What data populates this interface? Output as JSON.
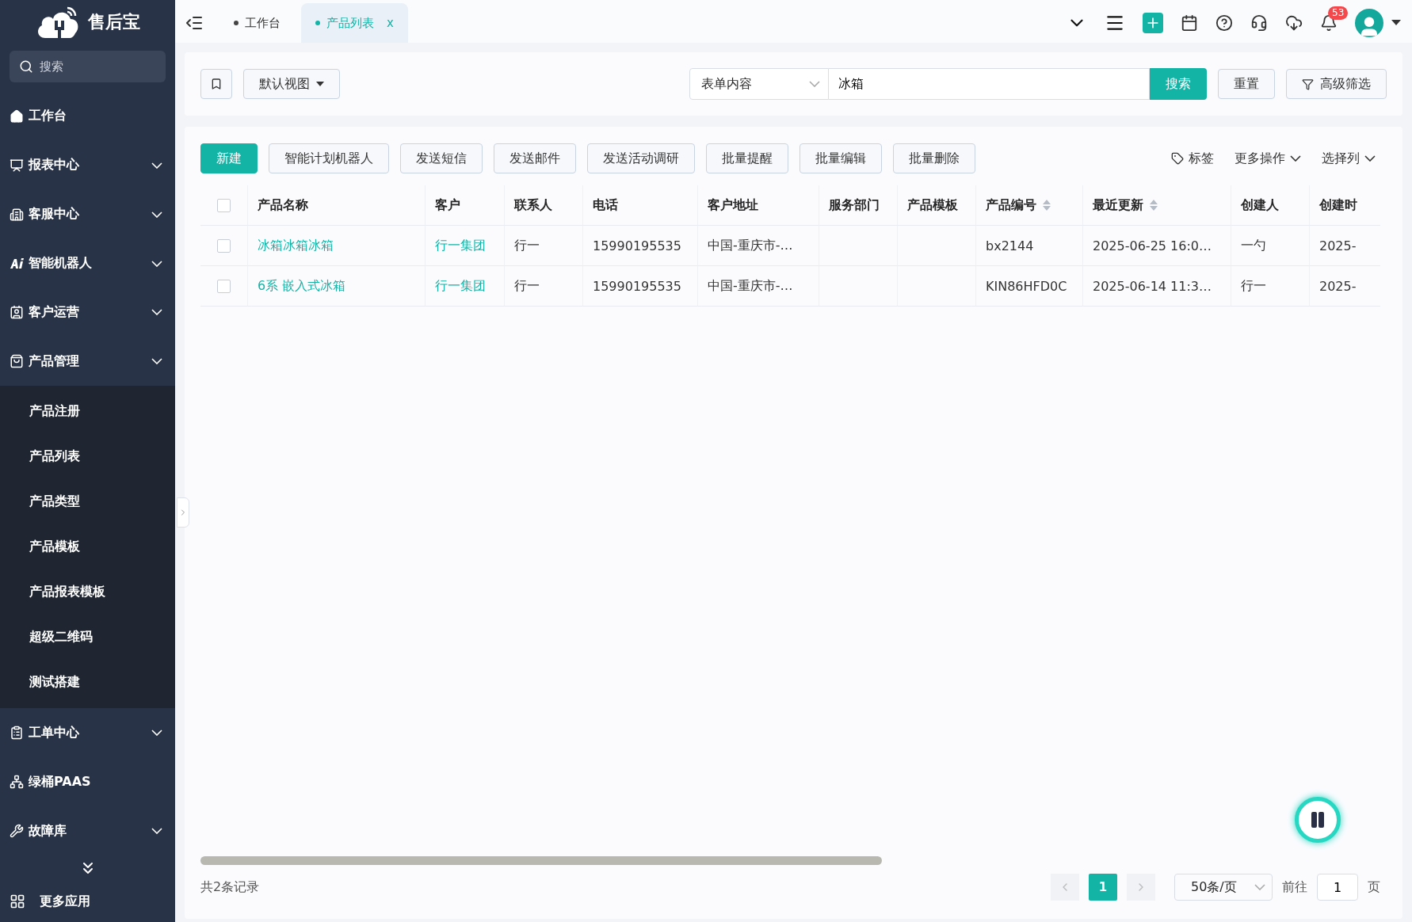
{
  "brand": {
    "name": "售后宝"
  },
  "sidebar": {
    "search": {
      "placeholder": "搜索"
    },
    "items": [
      {
        "label": "工作台"
      },
      {
        "label": "报表中心",
        "expanded": false
      },
      {
        "label": "客服中心",
        "expanded": false
      },
      {
        "label": "智能机器人",
        "expanded": false
      },
      {
        "label": "客户运营",
        "expanded": false
      },
      {
        "label": "产品管理",
        "expanded": true,
        "children": [
          {
            "label": "产品注册",
            "selected": false
          },
          {
            "label": "产品列表",
            "selected": false
          },
          {
            "label": "产品类型",
            "selected": false
          },
          {
            "label": "产品模板",
            "selected": false
          },
          {
            "label": "产品报表模板",
            "selected": false
          },
          {
            "label": "超级二维码",
            "selected": false
          },
          {
            "label": "测试搭建",
            "selected": false
          }
        ]
      },
      {
        "label": "工单中心",
        "expanded": false
      },
      {
        "label": "绿桶PAAS"
      },
      {
        "label": "故障库",
        "expanded": false
      }
    ],
    "more_apps": "更多应用"
  },
  "tabs": [
    {
      "label": "工作台",
      "selected": false,
      "closable": false
    },
    {
      "label": "产品列表",
      "selected": true,
      "closable": true
    }
  ],
  "close_tab_glyph": "x",
  "notifications": {
    "count": "53"
  },
  "filter_bar": {
    "view": "默认视图",
    "field": "表单内容",
    "query": "冰箱",
    "search": "搜索",
    "reset": "重置",
    "advanced": "高级筛选"
  },
  "actions": {
    "primary": "新建",
    "buttons": [
      "智能计划机器人",
      "发送短信",
      "发送邮件",
      "发送活动调研",
      "批量提醒",
      "批量编辑",
      "批量删除"
    ],
    "tag": "标签",
    "more": "更多操作",
    "columns": "选择列"
  },
  "table": {
    "all_checked": false,
    "columns": [
      {
        "label": "产品名称",
        "sortable": false
      },
      {
        "label": "客户",
        "sortable": false
      },
      {
        "label": "联系人",
        "sortable": false
      },
      {
        "label": "电话",
        "sortable": false
      },
      {
        "label": "客户地址",
        "sortable": false
      },
      {
        "label": "服务部门",
        "sortable": false
      },
      {
        "label": "产品模板",
        "sortable": false
      },
      {
        "label": "产品编号",
        "sortable": true
      },
      {
        "label": "最近更新",
        "sortable": true
      },
      {
        "label": "创建人",
        "sortable": false
      },
      {
        "label": "创建时",
        "sortable": false
      }
    ],
    "rows": [
      {
        "checked": false,
        "cells": [
          {
            "text": "冰箱冰箱冰箱",
            "kind": "link"
          },
          {
            "text": "行一集团",
            "kind": "link"
          },
          {
            "text": "行一",
            "kind": "text"
          },
          {
            "text": "15990195535",
            "kind": "text"
          },
          {
            "text": "中国-重庆市-…",
            "kind": "text"
          },
          {
            "text": "",
            "kind": "text"
          },
          {
            "text": "",
            "kind": "text"
          },
          {
            "text": "bx2144",
            "kind": "text"
          },
          {
            "text": "2025-06-25 16:0…",
            "kind": "text"
          },
          {
            "text": "一勺",
            "kind": "text"
          },
          {
            "text": "2025-",
            "kind": "text"
          }
        ]
      },
      {
        "checked": false,
        "cells": [
          {
            "text": "6系 嵌入式冰箱",
            "kind": "link"
          },
          {
            "text": "行一集团",
            "kind": "link"
          },
          {
            "text": "行一",
            "kind": "text"
          },
          {
            "text": "15990195535",
            "kind": "text"
          },
          {
            "text": "中国-重庆市-…",
            "kind": "text"
          },
          {
            "text": "",
            "kind": "text"
          },
          {
            "text": "",
            "kind": "text"
          },
          {
            "text": "KIN86HFD0C",
            "kind": "text"
          },
          {
            "text": "2025-06-14 11:3…",
            "kind": "text"
          },
          {
            "text": "行一",
            "kind": "text"
          },
          {
            "text": "2025-",
            "kind": "text"
          }
        ]
      }
    ]
  },
  "footer": {
    "total": "共2条记录",
    "pages": [
      {
        "label": "1",
        "selected": true
      }
    ],
    "page_size": "50条/页",
    "goto": "前往",
    "goto_value": "1",
    "page_unit": "页"
  }
}
